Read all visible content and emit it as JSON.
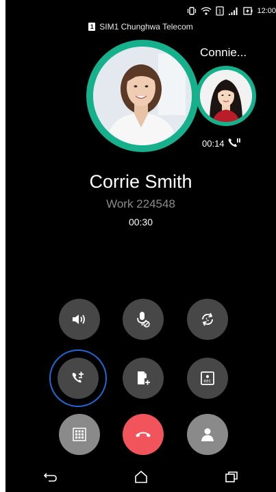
{
  "status_bar": {
    "time": "12:00",
    "sim_label": "1",
    "icons": [
      "vibrate-icon",
      "wifi-icon",
      "sim-icon",
      "signal-icon",
      "battery-charging-icon"
    ]
  },
  "carrier": {
    "sim_badge": "1",
    "text": "SIM1 Chunghwa Telecom"
  },
  "second_call": {
    "name": "Connie...",
    "timer": "00:14"
  },
  "caller": {
    "name": "Corrie Smith",
    "number": "Work 224548",
    "timer": "00:30"
  },
  "controls": {
    "row1": [
      "speaker-icon",
      "mute-icon",
      "swap-icon"
    ],
    "row2": [
      "merge-call-icon",
      "add-note-icon",
      "record-icon"
    ],
    "row3": [
      "keypad-icon",
      "end-call-icon",
      "contact-icon"
    ],
    "record_label": "REC"
  },
  "colors": {
    "accent_ring": "#17b08c",
    "end_call": "#f2545b",
    "highlight_ring": "#1e6ad6"
  },
  "navbar": [
    "back-icon",
    "home-icon",
    "recents-icon"
  ]
}
